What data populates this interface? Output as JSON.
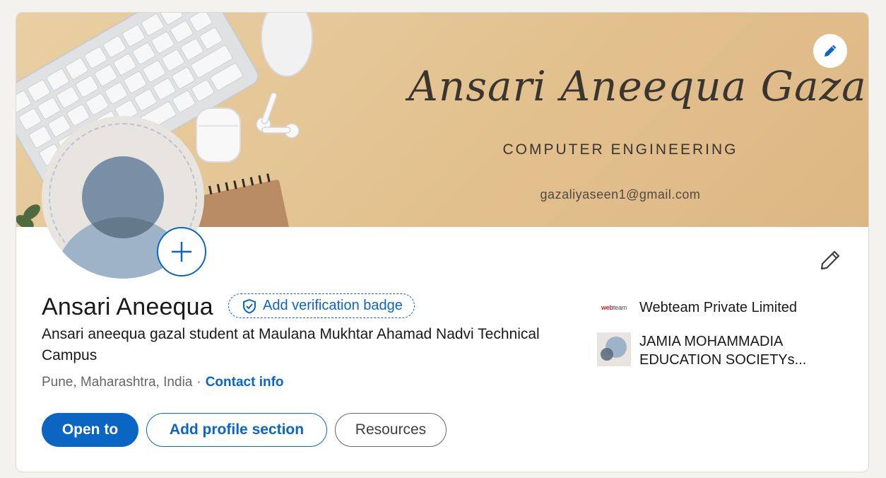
{
  "banner": {
    "name_text": "Ansari Aneequa Gazal",
    "subtitle": "COMPUTER ENGINEERING",
    "email": "gazaliyaseen1@gmail.com"
  },
  "icons": {
    "edit_banner": "pencil-icon",
    "add_photo": "plus-icon",
    "edit_intro": "pencil-icon",
    "verification": "shield-check-icon"
  },
  "profile": {
    "name": "Ansari Aneequa",
    "verification_label": "Add verification badge",
    "headline": "Ansari aneequa gazal student at Maulana Mukhtar Ahamad Nadvi Technical Campus",
    "location": "Pune, Maharashtra, India",
    "separator": "·",
    "contact_label": "Contact info"
  },
  "actions": {
    "open_to": "Open to",
    "add_section": "Add profile section",
    "resources": "Resources"
  },
  "organizations": [
    {
      "logo_text_a": "web",
      "logo_text_b": "team",
      "name": "Webteam Private Limited"
    },
    {
      "name": "JAMIA MOHAMMADIA EDUCATION SOCIETYs..."
    }
  ],
  "colors": {
    "accent": "#0a66c2",
    "banner": "#e2c08e",
    "page_bg": "#f4f2ee"
  }
}
